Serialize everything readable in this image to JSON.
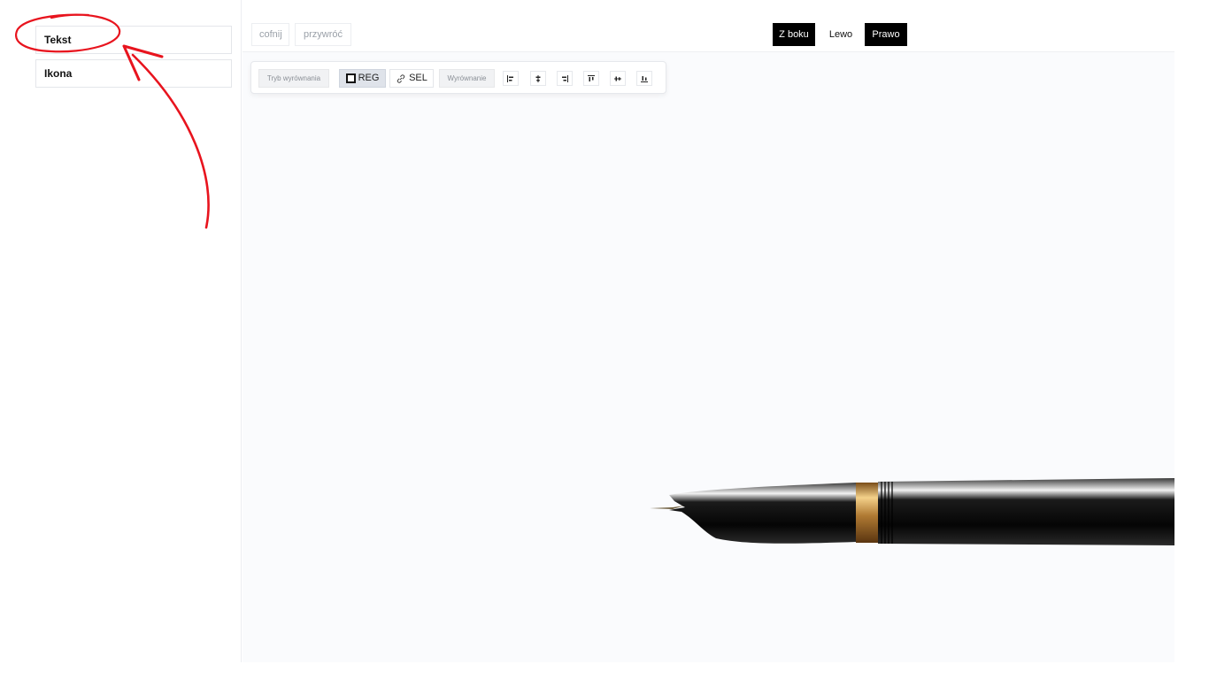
{
  "sidebar": {
    "items": [
      {
        "label": "Tekst"
      },
      {
        "label": "Ikona"
      }
    ]
  },
  "history": {
    "undo_label": "cofnij",
    "redo_label": "przywróć"
  },
  "view_switch": {
    "side_label": "Z boku",
    "left_label": "Lewo",
    "right_label": "Prawo"
  },
  "toolbar": {
    "align_mode_tag": "Tryb wyrównania",
    "reg_label": "REG",
    "sel_label": "SEL",
    "alignment_tag": "Wyrównanie",
    "align_icons": [
      "align-left-icon",
      "align-center-horizontal-icon",
      "align-right-icon",
      "align-top-icon",
      "align-center-vertical-icon",
      "align-bottom-icon"
    ]
  },
  "colors": {
    "annotation": "#e8141e",
    "active_toggle": "#000000",
    "reg_active": "#dfe3ea",
    "pen_gold": "#c9934a"
  }
}
